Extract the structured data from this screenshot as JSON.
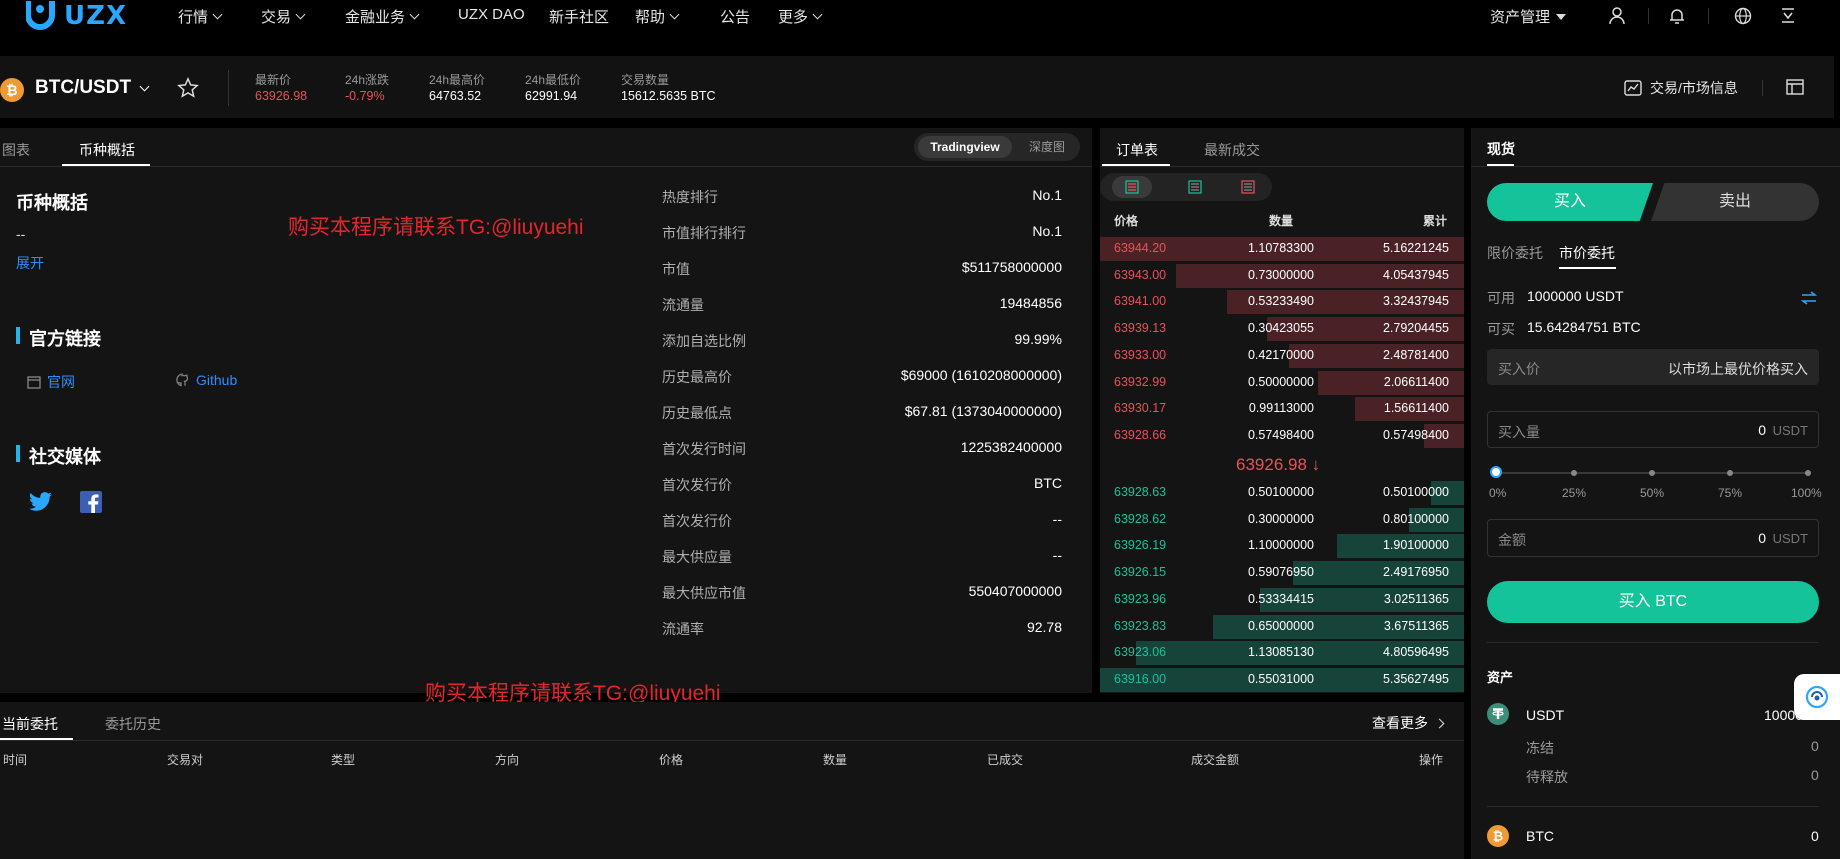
{
  "brand": {
    "name": "UZX"
  },
  "nav": {
    "items": [
      {
        "label": "行情",
        "dropdown": true
      },
      {
        "label": "交易",
        "dropdown": true
      },
      {
        "label": "金融业务",
        "dropdown": true
      },
      {
        "label": "UZX DAO",
        "dropdown": false
      },
      {
        "label": "新手社区",
        "dropdown": false
      },
      {
        "label": "帮助",
        "dropdown": true
      },
      {
        "label": "公告",
        "dropdown": false
      },
      {
        "label": "更多",
        "dropdown": true
      }
    ],
    "asset_mgmt": "资产管理"
  },
  "ticker": {
    "pair": "BTC/USDT",
    "stats": [
      {
        "label": "最新价",
        "value": "63926.98",
        "tone": "down"
      },
      {
        "label": "24h涨跌",
        "value": "-0.79%",
        "tone": "down"
      },
      {
        "label": "24h最高价",
        "value": "64763.52",
        "tone": "neutral"
      },
      {
        "label": "24h最低价",
        "value": "62991.94",
        "tone": "neutral"
      },
      {
        "label": "交易数量",
        "value": "15612.5635 BTC",
        "tone": "neutral"
      }
    ],
    "market_info": "交易/市场信息"
  },
  "left_panel": {
    "tabs": [
      "图表",
      "币种概括"
    ],
    "active_tab": "币种概括",
    "toggle": [
      "Tradingview",
      "深度图"
    ],
    "overview_title": "币种概括",
    "overview_desc": "--",
    "expand": "展开",
    "links_title": "官方链接",
    "links": [
      "官网",
      "Github"
    ],
    "social_title": "社交媒体",
    "watermark": "购买本程序请联系TG:@liuyuehi",
    "info": [
      {
        "k": "热度排行",
        "v": "No.1"
      },
      {
        "k": "市值排行排行",
        "v": "No.1"
      },
      {
        "k": "市值",
        "v": "$511758000000"
      },
      {
        "k": "流通量",
        "v": "19484856"
      },
      {
        "k": "添加自选比例",
        "v": "99.99%"
      },
      {
        "k": "历史最高价",
        "v": "$69000 (1610208000000)"
      },
      {
        "k": "历史最低点",
        "v": "$67.81 (1373040000000)"
      },
      {
        "k": "首次发行时间",
        "v": "1225382400000"
      },
      {
        "k": "首次发行价",
        "v": "BTC"
      },
      {
        "k": "首次发行价",
        "v": "--"
      },
      {
        "k": "最大供应量",
        "v": "--"
      },
      {
        "k": "最大供应市值",
        "v": "550407000000"
      },
      {
        "k": "流通率",
        "v": "92.78"
      }
    ]
  },
  "orderbook": {
    "tabs": [
      "订单表",
      "最新成交"
    ],
    "headers": [
      "价格",
      "数量",
      "累计"
    ],
    "asks": [
      {
        "price": "63944.20",
        "amount": "1.10783300",
        "total": "5.16221245",
        "depth": 1.0
      },
      {
        "price": "63943.00",
        "amount": "0.73000000",
        "total": "4.05437945",
        "depth": 0.79
      },
      {
        "price": "63941.00",
        "amount": "0.53233490",
        "total": "3.32437945",
        "depth": 0.65
      },
      {
        "price": "63939.13",
        "amount": "0.30423055",
        "total": "2.79204455",
        "depth": 0.54
      },
      {
        "price": "63933.00",
        "amount": "0.42170000",
        "total": "2.48781400",
        "depth": 0.48
      },
      {
        "price": "63932.99",
        "amount": "0.50000000",
        "total": "2.06611400",
        "depth": 0.4
      },
      {
        "price": "63930.17",
        "amount": "0.99113000",
        "total": "1.56611400",
        "depth": 0.3
      },
      {
        "price": "63928.66",
        "amount": "0.57498400",
        "total": "0.57498400",
        "depth": 0.11
      }
    ],
    "last_price": "63926.98 ↓",
    "bids": [
      {
        "price": "63928.63",
        "amount": "0.50100000",
        "total": "0.50100000",
        "depth": 0.09
      },
      {
        "price": "63928.62",
        "amount": "0.30000000",
        "total": "0.80100000",
        "depth": 0.15
      },
      {
        "price": "63926.19",
        "amount": "1.10000000",
        "total": "1.90100000",
        "depth": 0.35
      },
      {
        "price": "63926.15",
        "amount": "0.59076950",
        "total": "2.49176950",
        "depth": 0.47
      },
      {
        "price": "63923.96",
        "amount": "0.53334415",
        "total": "3.02511365",
        "depth": 0.56
      },
      {
        "price": "63923.83",
        "amount": "0.65000000",
        "total": "3.67511365",
        "depth": 0.69
      },
      {
        "price": "63923.06",
        "amount": "1.13085130",
        "total": "4.80596495",
        "depth": 0.9
      },
      {
        "price": "63916.00",
        "amount": "0.55031000",
        "total": "5.35627495",
        "depth": 1.0
      }
    ]
  },
  "trade": {
    "tab": "现货",
    "buy": "买入",
    "sell": "卖出",
    "order_types": [
      "限价委托",
      "市价委托"
    ],
    "active_type": "市价委托",
    "avail_label": "可用",
    "avail_value": "1000000 USDT",
    "buyable_label": "可买",
    "buyable_value": "15.64284751 BTC",
    "price_label": "买入价",
    "price_value": "以市场上最优价格买入",
    "amount_label": "买入量",
    "amount_value": "0",
    "amount_unit": "USDT",
    "slider_marks": [
      "0%",
      "25%",
      "50%",
      "75%",
      "100%"
    ],
    "slider_value": 0,
    "total_label": "金额",
    "total_value": "0",
    "total_unit": "USDT",
    "submit": "买入 BTC",
    "assets_title": "资产",
    "assets": {
      "usdt_name": "USDT",
      "usdt_value": "1000000",
      "frozen_label": "冻结",
      "frozen_value": "0",
      "pending_label": "待释放",
      "pending_value": "0",
      "btc_name": "BTC",
      "btc_value": "0"
    }
  },
  "orders": {
    "tabs": [
      "当前委托",
      "委托历史"
    ],
    "more": "查看更多",
    "headers": [
      "时间",
      "交易对",
      "类型",
      "方向",
      "价格",
      "数量",
      "已成交",
      "成交金额",
      "操作"
    ]
  },
  "colors": {
    "up": "#15c39a",
    "down": "#e9525a",
    "accent": "#2aa7ff",
    "bg": "#000000",
    "panel": "#141414"
  }
}
